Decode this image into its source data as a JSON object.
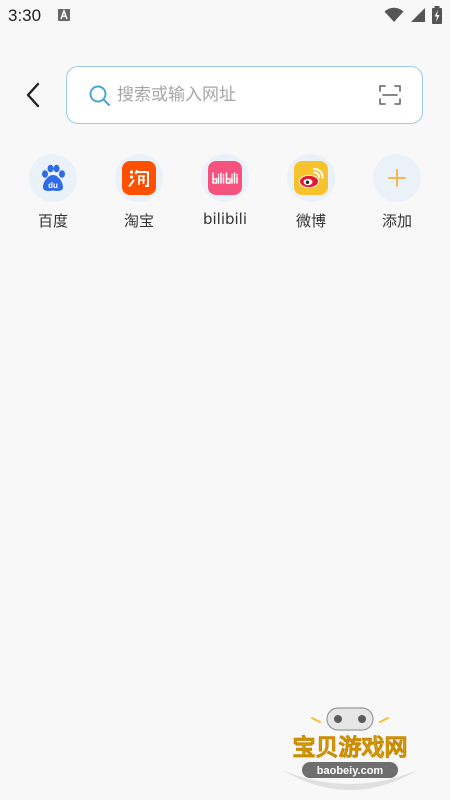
{
  "status_bar": {
    "time": "3:30",
    "icons": [
      "notification-a-icon",
      "wifi-icon",
      "signal-icon",
      "battery-charging-icon"
    ]
  },
  "search": {
    "placeholder": "搜索或输入网址",
    "value": ""
  },
  "shortcuts": [
    {
      "label": "百度",
      "icon": "baidu-icon"
    },
    {
      "label": "淘宝",
      "icon": "taobao-icon"
    },
    {
      "label": "bilibili",
      "icon": "bilibili-icon"
    },
    {
      "label": "微博",
      "icon": "weibo-icon"
    },
    {
      "label": "添加",
      "icon": "plus-icon"
    }
  ],
  "colors": {
    "accent": "#4aa8d8",
    "search_border": "#9ccbe4",
    "shortcut_bg": "#eaf1f8",
    "add_plus": "#f5b84a",
    "taobao": "#ff5000",
    "bilibili": "#f5537d",
    "baidu": "#2f6be6",
    "weibo": "#f6c22e"
  }
}
